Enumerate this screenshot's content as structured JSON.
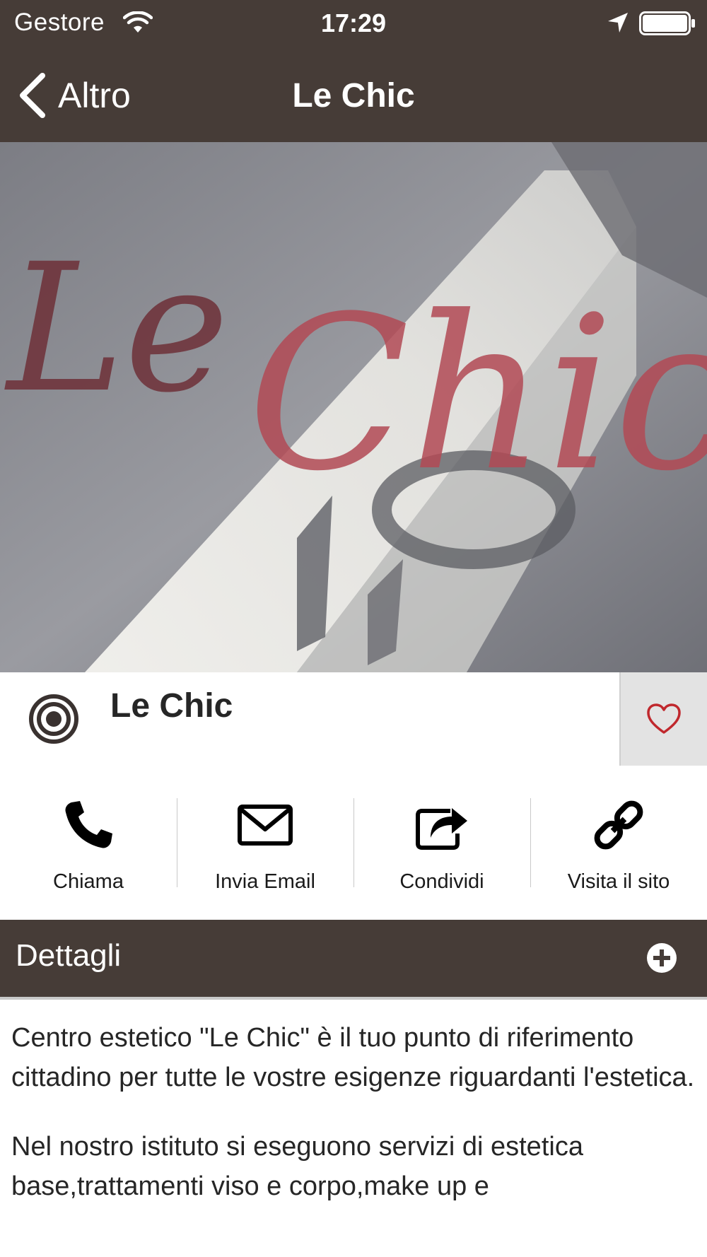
{
  "status_bar": {
    "carrier": "Gestore",
    "time": "17:29",
    "icons": [
      "wifi-icon",
      "location-icon",
      "battery-icon"
    ]
  },
  "nav": {
    "back_label": "Altro",
    "title": "Le Chic"
  },
  "hero": {
    "sign_text_1": "Le",
    "sign_text_2": "Chic"
  },
  "place": {
    "name": "Le Chic",
    "logo_icon": "target-icon",
    "favorite_icon": "heart-icon"
  },
  "actions": [
    {
      "label": "Chiama",
      "icon": "phone-icon"
    },
    {
      "label": "Invia Email",
      "icon": "envelope-icon"
    },
    {
      "label": "Condividi",
      "icon": "share-icon"
    },
    {
      "label": "Visita il sito",
      "icon": "link-icon"
    }
  ],
  "details": {
    "title": "Dettagli",
    "expand_icon": "plus-circle-icon",
    "paragraphs": [
      "Centro estetico \"Le Chic\" è il tuo punto di riferimento cittadino per tutte le vostre esigenze riguardanti l'estetica.",
      "Nel nostro istituto si eseguono servizi di estetica base,trattamenti viso e corpo,make up e"
    ]
  },
  "colors": {
    "bar_background": "#463c37",
    "favorite_heart": "#c0282d",
    "sign_dark": "#6e3038",
    "sign_light": "#e0707a"
  }
}
